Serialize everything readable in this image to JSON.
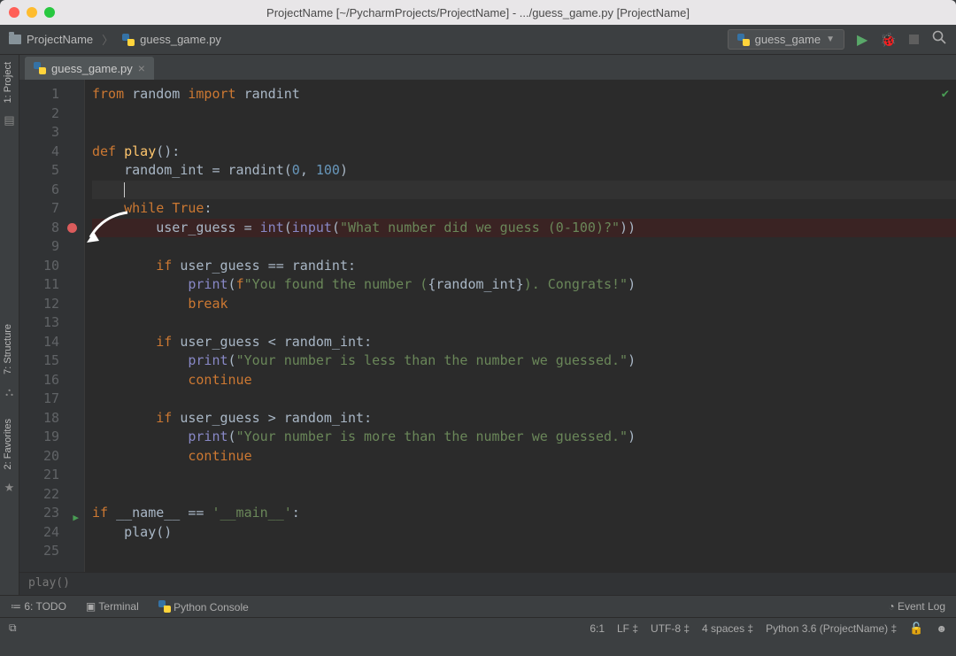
{
  "window": {
    "title": "ProjectName [~/PycharmProjects/ProjectName] - .../guess_game.py [ProjectName]"
  },
  "breadcrumb": {
    "project": "ProjectName",
    "file": "guess_game.py"
  },
  "run_config": {
    "label": "guess_game"
  },
  "tabs": [
    {
      "label": "guess_game.py"
    }
  ],
  "left_tools": {
    "project": "1: Project",
    "structure": "7: Structure",
    "favorites": "2: Favorites"
  },
  "code": {
    "total_lines": 25,
    "breakpoint_line": 8,
    "cursor_line": 6,
    "run_marker_line": 23,
    "lines": {
      "1": [
        [
          "kw",
          "from "
        ],
        [
          "id",
          "random "
        ],
        [
          "kw",
          "import "
        ],
        [
          "id",
          "randint"
        ]
      ],
      "2": [],
      "3": [],
      "4": [
        [
          "kw",
          "def "
        ],
        [
          "fn",
          "play"
        ],
        [
          "pn",
          "():"
        ]
      ],
      "5": [
        [
          "id",
          "    random_int "
        ],
        [
          "pn",
          "= "
        ],
        [
          "id",
          "randint"
        ],
        [
          "pn",
          "("
        ],
        [
          "num",
          "0"
        ],
        [
          "pn",
          ", "
        ],
        [
          "num",
          "100"
        ],
        [
          "pn",
          ")"
        ]
      ],
      "6": [
        [
          "id",
          "    "
        ]
      ],
      "7": [
        [
          "id",
          "    "
        ],
        [
          "kw",
          "while "
        ],
        [
          "kw",
          "True"
        ],
        [
          "pn",
          ":"
        ]
      ],
      "8": [
        [
          "id",
          "        user_guess "
        ],
        [
          "pn",
          "= "
        ],
        [
          "bi",
          "int"
        ],
        [
          "pn",
          "("
        ],
        [
          "bi",
          "input"
        ],
        [
          "pn",
          "("
        ],
        [
          "str",
          "\"What number did we guess (0-100)?\""
        ],
        [
          "pn",
          "))"
        ]
      ],
      "9": [],
      "10": [
        [
          "id",
          "        "
        ],
        [
          "kw",
          "if "
        ],
        [
          "id",
          "user_guess "
        ],
        [
          "pn",
          "== "
        ],
        [
          "id",
          "randint"
        ],
        [
          "pn",
          ":"
        ]
      ],
      "11": [
        [
          "id",
          "            "
        ],
        [
          "bi",
          "print"
        ],
        [
          "pn",
          "("
        ],
        [
          "kw",
          "f"
        ],
        [
          "str",
          "\"You found the number ("
        ],
        [
          "pn",
          "{"
        ],
        [
          "id",
          "random_int"
        ],
        [
          "pn",
          "}"
        ],
        [
          "str",
          "). Congrats!\""
        ],
        [
          "pn",
          ")"
        ]
      ],
      "12": [
        [
          "id",
          "            "
        ],
        [
          "kw",
          "break"
        ]
      ],
      "13": [],
      "14": [
        [
          "id",
          "        "
        ],
        [
          "kw",
          "if "
        ],
        [
          "id",
          "user_guess "
        ],
        [
          "pn",
          "< "
        ],
        [
          "id",
          "random_int"
        ],
        [
          "pn",
          ":"
        ]
      ],
      "15": [
        [
          "id",
          "            "
        ],
        [
          "bi",
          "print"
        ],
        [
          "pn",
          "("
        ],
        [
          "str",
          "\"Your number is less than the number we guessed.\""
        ],
        [
          "pn",
          ")"
        ]
      ],
      "16": [
        [
          "id",
          "            "
        ],
        [
          "kw",
          "continue"
        ]
      ],
      "17": [],
      "18": [
        [
          "id",
          "        "
        ],
        [
          "kw",
          "if "
        ],
        [
          "id",
          "user_guess "
        ],
        [
          "pn",
          "> "
        ],
        [
          "id",
          "random_int"
        ],
        [
          "pn",
          ":"
        ]
      ],
      "19": [
        [
          "id",
          "            "
        ],
        [
          "bi",
          "print"
        ],
        [
          "pn",
          "("
        ],
        [
          "str",
          "\"Your number is more than the number we guessed.\""
        ],
        [
          "pn",
          ")"
        ]
      ],
      "20": [
        [
          "id",
          "            "
        ],
        [
          "kw",
          "continue"
        ]
      ],
      "21": [],
      "22": [],
      "23": [
        [
          "kw",
          "if "
        ],
        [
          "id",
          "__name__ "
        ],
        [
          "pn",
          "== "
        ],
        [
          "str",
          "'__main__'"
        ],
        [
          "pn",
          ":"
        ]
      ],
      "24": [
        [
          "id",
          "    play"
        ],
        [
          "pn",
          "()"
        ]
      ],
      "25": []
    }
  },
  "breadcrumb_bar": "play()",
  "bottom_tools": {
    "todo": "6: TODO",
    "terminal": "Terminal",
    "python_console": "Python Console",
    "event_log": "Event Log"
  },
  "statusbar": {
    "position": "6:1",
    "line_sep": "LF",
    "encoding": "UTF-8",
    "indent": "4 spaces",
    "interpreter": "Python 3.6 (ProjectName)"
  }
}
